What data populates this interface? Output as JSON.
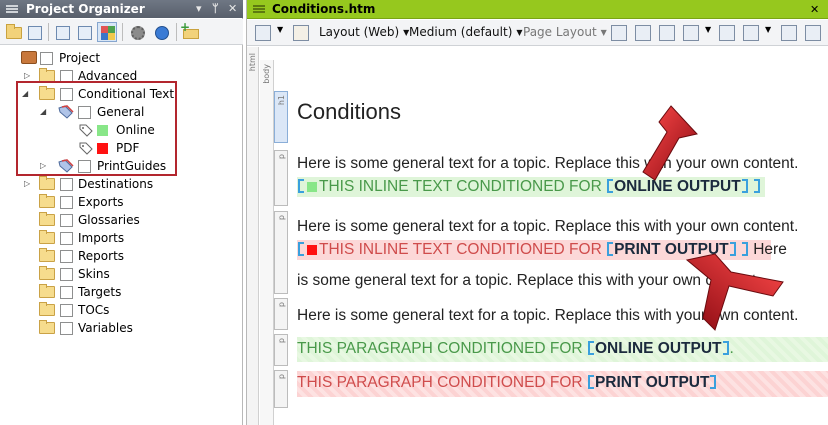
{
  "left_panel": {
    "title": "Project Organizer",
    "controls": [
      "▾",
      "ᛘ",
      "✕"
    ],
    "tree": [
      {
        "label": "Project",
        "level": 0,
        "icon": "briefcase"
      },
      {
        "label": "Advanced",
        "level": 1,
        "icon": "folder"
      },
      {
        "label": "Conditional Text",
        "level": 1,
        "icon": "folder-open"
      },
      {
        "label": "General",
        "level": 2,
        "icon": "tag-set"
      },
      {
        "label": "Online",
        "level": 3,
        "icon": "tag",
        "swatch": "#88e688"
      },
      {
        "label": "PDF",
        "level": 3,
        "icon": "tag",
        "swatch": "#ff1111"
      },
      {
        "label": "PrintGuides",
        "level": 2,
        "icon": "tag-set"
      },
      {
        "label": "Destinations",
        "level": 1,
        "icon": "folder"
      },
      {
        "label": "Exports",
        "level": 1,
        "icon": "folder"
      },
      {
        "label": "Glossaries",
        "level": 1,
        "icon": "folder"
      },
      {
        "label": "Imports",
        "level": 1,
        "icon": "folder"
      },
      {
        "label": "Reports",
        "level": 1,
        "icon": "folder"
      },
      {
        "label": "Skins",
        "level": 1,
        "icon": "folder"
      },
      {
        "label": "Targets",
        "level": 1,
        "icon": "folder"
      },
      {
        "label": "TOCs",
        "level": 1,
        "icon": "folder"
      },
      {
        "label": "Variables",
        "level": 1,
        "icon": "folder"
      }
    ]
  },
  "right_panel": {
    "title": "Conditions.htm",
    "toolbar": {
      "layout": "Layout (Web)",
      "medium": "Medium (default)",
      "page_layout": "Page Layout"
    },
    "ruler_tags": {
      "html": "html",
      "body": "body",
      "h1": "h1",
      "p": "p"
    },
    "content": {
      "heading": "Conditions",
      "general_text_1": "Here is some general text for a topic. Replace this with your own content.",
      "inline_online": "THIS INLINE TEXT CONDITIONED FOR",
      "online_output": "ONLINE OUTPUT",
      "general_text_2": "Here is some general text for a topic. Replace this with your own content.",
      "inline_print": "THIS INLINE TEXT CONDITIONED FOR",
      "print_output": "PRINT OUTPUT",
      "after_print_1": "Here",
      "after_print_2": "is some general text for a topic. Replace this with your own content.",
      "general_text_3": "Here is some general text for a topic. Replace this with your own content.",
      "para_online": "THIS PARAGRAPH CONDITIONED FOR",
      "para_print": "THIS PARAGRAPH CONDITIONED FOR",
      "period": "."
    },
    "colors": {
      "title_bar": "#96c81e",
      "online": "#dff5d9",
      "print": "#fcd8d8",
      "bracket": "#3aa0dd",
      "arrow": "#c8101e"
    }
  }
}
